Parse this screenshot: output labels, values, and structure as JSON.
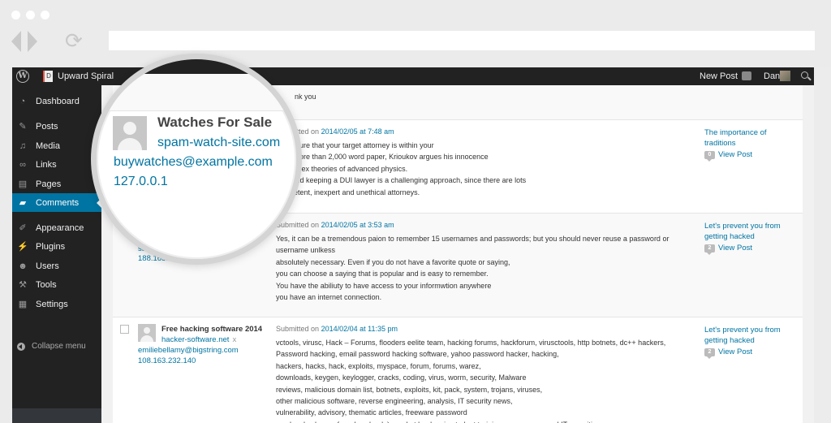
{
  "browser": {
    "url": ""
  },
  "adminbar": {
    "site_name": "Upward Spiral",
    "site_icon_letter": "D",
    "new_post": "New Post",
    "user_name": "Dan"
  },
  "sidebar": {
    "items": [
      {
        "label": "Dashboard",
        "icon": "dashboard-icon",
        "glyph": "◔"
      },
      {
        "label": "Posts",
        "icon": "pin-icon",
        "glyph": "✎"
      },
      {
        "label": "Media",
        "icon": "media-icon",
        "glyph": "♫"
      },
      {
        "label": "Links",
        "icon": "link-icon",
        "glyph": "∞"
      },
      {
        "label": "Pages",
        "icon": "pages-icon",
        "glyph": "▤"
      },
      {
        "label": "Comments",
        "icon": "comment-icon",
        "glyph": "▰",
        "active": true
      },
      {
        "label": "Appearance",
        "icon": "brush-icon",
        "glyph": "✐"
      },
      {
        "label": "Plugins",
        "icon": "plug-icon",
        "glyph": "⚡"
      },
      {
        "label": "Users",
        "icon": "user-icon",
        "glyph": "☻"
      },
      {
        "label": "Tools",
        "icon": "wrench-icon",
        "glyph": "⚒"
      },
      {
        "label": "Settings",
        "icon": "settings-icon",
        "glyph": "▦"
      }
    ],
    "collapse": "Collapse menu"
  },
  "partial_row": {
    "text": "nk you"
  },
  "comments": [
    {
      "author": "Watches For Sale",
      "url": "spam-watch-site.com",
      "email": "buywatches@example.com",
      "ip": "127.0.0.1",
      "submitted_prefix": "Submitted on",
      "date": "2014/02/05 at 7:48 am",
      "text": "make sure that your target attorney is within your\nn his more than 2,000 word paper, Krioukov argues his innocence\ng complex theories of advanced physics.\nning and keeping a DUI lawyer is a challenging approach, since there are lots\ncompetent, inexpert and unethical attorneys.",
      "post_title": "The importance of traditions",
      "comment_count": "0",
      "view_post": "View Post"
    },
    {
      "author": "",
      "url": "",
      "email": "sangceo...",
      "ip": "188.165.157.8",
      "submitted_prefix": "Submitted on",
      "date": "2014/02/05 at 3:53 am",
      "text": "Yes, it can be a tremendous paion to remember 15 usernames and passwords; but you should never reuse a password or username unlkess\nabsolutely necessary. Even if you do not have a favorite quote or saying,\nyou can choose a saying that is popular and is easy to remember.\nYou have the abiliuty to have access to your informwtion anywhere\nyou have an internet connection.",
      "post_title": "Let's prevent you from getting hacked",
      "comment_count": "2",
      "view_post": "View Post"
    },
    {
      "author": "Free hacking software 2014",
      "url": "hacker-software.net",
      "url_x": "x",
      "email": "emiliebellamy@bigstring.com",
      "ip": "108.163.232.140",
      "submitted_prefix": "Submitted on",
      "date": "2014/02/04 at 11:35 pm",
      "text": "vctools, virusc, Hack – Forums, flooders eelite team, hacking forums, hackforum, virusctools, http botnets, dc++ hackers,\nPassword hacking, email password hacking software, yahoo password hacker, hacking,\nhackers, hacks, hack, exploits, myspace, forum, forums, warez,\ndownloads, keygen, keylogger, cracks, coding, virus, worm, security, Malware\nreviews, malicious domain list, botnets, exploits, kit, pack, system, trojans, viruses,\nother malicious software, reverse engineering, analysis, IT security news,\nvulnerability, advisory, thematic articles, freeware password\ncracker, keylogger free download. ), market leaders in student training programmes and IT securities,",
      "post_title": "Let's prevent you from getting hacked",
      "comment_count": "2",
      "view_post": "View Post"
    }
  ],
  "magnifier": {
    "author": "Watches For Sale",
    "url": "spam-watch-site.com",
    "email": "buywatches@example.com",
    "ip": "127.0.0.1"
  },
  "colors": {
    "link": "#0074a2",
    "adminbar": "#222222",
    "active_menu": "#0074a2"
  }
}
